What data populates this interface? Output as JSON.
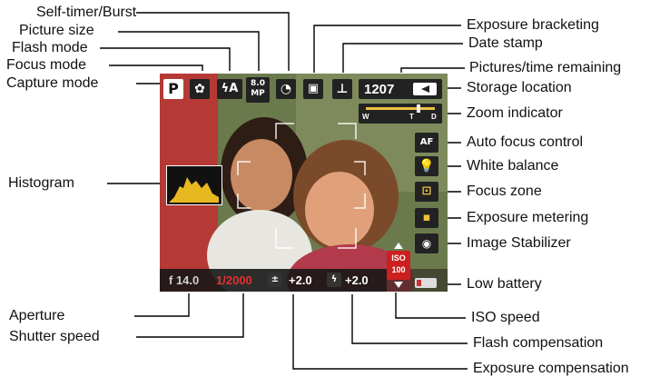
{
  "labels": {
    "self_timer_burst": "Self-timer/Burst",
    "picture_size": "Picture size",
    "flash_mode": "Flash mode",
    "focus_mode": "Focus mode",
    "capture_mode": "Capture mode",
    "histogram": "Histogram",
    "aperture": "Aperture",
    "shutter_speed": "Shutter speed",
    "exposure_bracketing": "Exposure bracketing",
    "date_stamp": "Date stamp",
    "pictures_time_remaining": "Pictures/time remaining",
    "storage_location": "Storage location",
    "zoom_indicator": "Zoom indicator",
    "auto_focus_control": "Auto focus control",
    "white_balance": "White balance",
    "focus_zone": "Focus zone",
    "exposure_metering": "Exposure metering",
    "image_stabilizer": "Image Stabilizer",
    "low_battery": "Low battery",
    "iso_speed": "ISO speed",
    "flash_compensation": "Flash compensation",
    "exposure_compensation": "Exposure compensation"
  },
  "screen": {
    "capture_mode_letter": "P",
    "flash_mode_value": "ϟA",
    "picture_size_value": "8.0 MP",
    "pictures_remaining": "1207",
    "zoom_w": "W",
    "zoom_t": "T",
    "zoom_d": "D",
    "af_label": "AF",
    "aperture_value": "f 14.0",
    "shutter_value": "1/2000",
    "exposure_comp_value": "+2.0",
    "flash_comp_value": "+2.0",
    "iso_top": "ISO",
    "iso_bottom": "100"
  },
  "colors": {
    "shutter": "#e53030",
    "iso_bg": "#cc1f1f",
    "histogram": "#e8b820"
  }
}
